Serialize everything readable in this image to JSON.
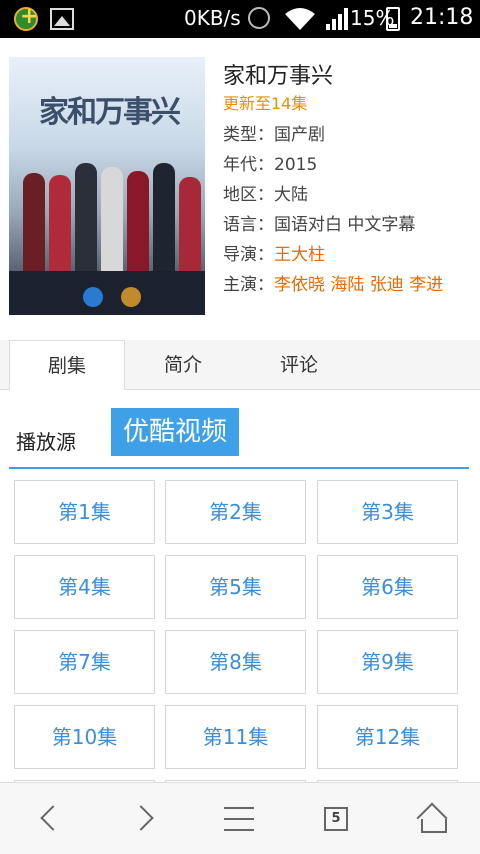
{
  "status_bar": {
    "speed": "0KB/s",
    "battery": "15%",
    "time": "21:18"
  },
  "show": {
    "title": "家和万事兴",
    "update": "更新至14集",
    "poster_title": "家和万事兴",
    "rows": [
      {
        "key": "类型：",
        "value": "国产剧"
      },
      {
        "key": "年代：",
        "value": "2015"
      },
      {
        "key": "地区：",
        "value": "大陆"
      },
      {
        "key": "语言：",
        "value": "国语对白 中文字幕"
      },
      {
        "key": "导演：",
        "value": "王大柱"
      },
      {
        "key": "主演：",
        "value": "李依晓 海陆 张迪 李进"
      }
    ]
  },
  "tabs": [
    "剧集",
    "简介",
    "评论"
  ],
  "source": {
    "label": "播放源",
    "selected": "优酷视频"
  },
  "episodes": [
    "第1集",
    "第2集",
    "第3集",
    "第4集",
    "第5集",
    "第6集",
    "第7集",
    "第8集",
    "第9集",
    "第10集",
    "第11集",
    "第12集"
  ],
  "bottom_nav": {
    "tab_count": "5"
  },
  "colors": {
    "accent": "#3ea0e6",
    "update": "#f08c00",
    "link": "#e86a00",
    "episode_text": "#3b8fd8"
  },
  "icons": [
    "game-icon",
    "image-icon",
    "alarm-icon",
    "wifi-icon",
    "signal-icon",
    "battery-icon",
    "back-chevron-icon",
    "forward-chevron-icon",
    "menu-icon",
    "tabs-icon",
    "home-icon"
  ]
}
